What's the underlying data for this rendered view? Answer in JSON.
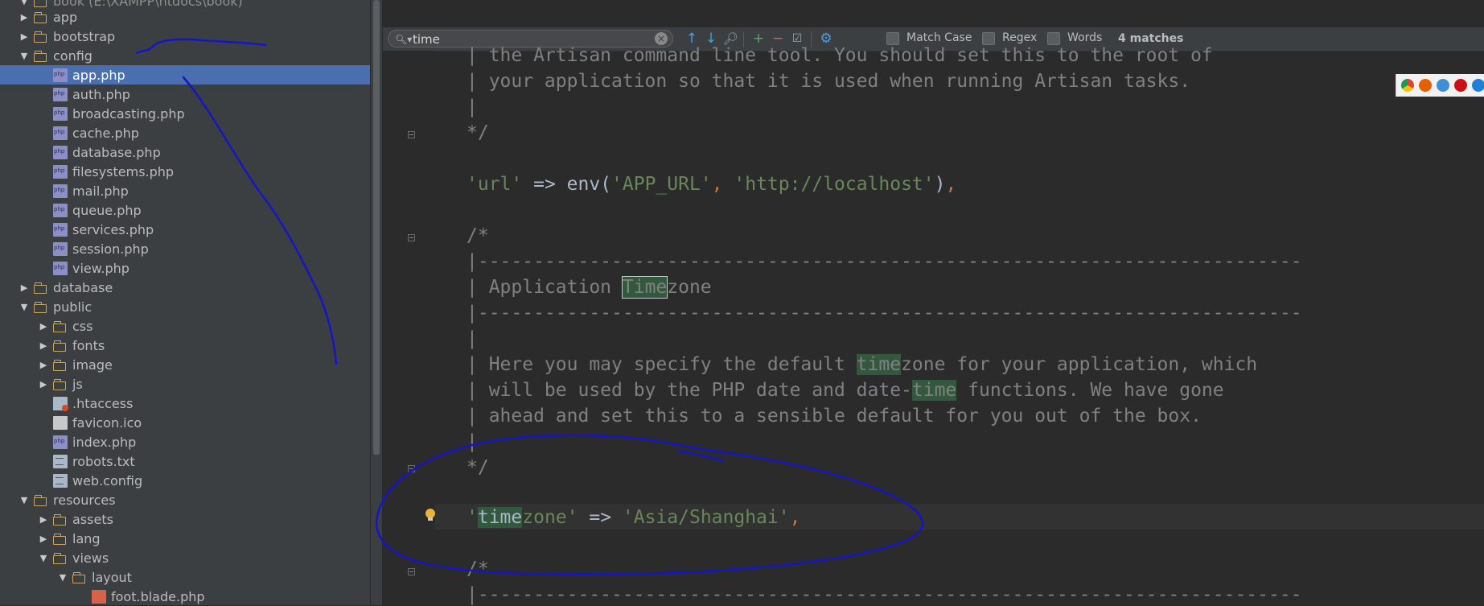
{
  "project_tree": {
    "root_label": "book (E:\\XAMPP\\htdocs\\book)",
    "rows": [
      {
        "label": "app",
        "type": "folder",
        "indent": 0,
        "arrow": "▶"
      },
      {
        "label": "bootstrap",
        "type": "folder",
        "indent": 0,
        "arrow": "▶"
      },
      {
        "label": "config",
        "type": "folder",
        "indent": 0,
        "arrow": "▼"
      },
      {
        "label": "app.php",
        "type": "php",
        "indent": 1,
        "arrow": "",
        "selected": true
      },
      {
        "label": "auth.php",
        "type": "php",
        "indent": 1,
        "arrow": ""
      },
      {
        "label": "broadcasting.php",
        "type": "php",
        "indent": 1,
        "arrow": ""
      },
      {
        "label": "cache.php",
        "type": "php",
        "indent": 1,
        "arrow": ""
      },
      {
        "label": "database.php",
        "type": "php",
        "indent": 1,
        "arrow": ""
      },
      {
        "label": "filesystems.php",
        "type": "php",
        "indent": 1,
        "arrow": ""
      },
      {
        "label": "mail.php",
        "type": "php",
        "indent": 1,
        "arrow": ""
      },
      {
        "label": "queue.php",
        "type": "php",
        "indent": 1,
        "arrow": ""
      },
      {
        "label": "services.php",
        "type": "php",
        "indent": 1,
        "arrow": ""
      },
      {
        "label": "session.php",
        "type": "php",
        "indent": 1,
        "arrow": ""
      },
      {
        "label": "view.php",
        "type": "php",
        "indent": 1,
        "arrow": ""
      },
      {
        "label": "database",
        "type": "folder",
        "indent": 0,
        "arrow": "▶"
      },
      {
        "label": "public",
        "type": "folder",
        "indent": 0,
        "arrow": "▼"
      },
      {
        "label": "css",
        "type": "folder",
        "indent": 1,
        "arrow": "▶"
      },
      {
        "label": "fonts",
        "type": "folder",
        "indent": 1,
        "arrow": "▶"
      },
      {
        "label": "image",
        "type": "folder",
        "indent": 1,
        "arrow": "▶"
      },
      {
        "label": "js",
        "type": "folder",
        "indent": 1,
        "arrow": "▶"
      },
      {
        "label": ".htaccess",
        "type": "htaccess",
        "indent": 1,
        "arrow": ""
      },
      {
        "label": "favicon.ico",
        "type": "ico",
        "indent": 1,
        "arrow": ""
      },
      {
        "label": "index.php",
        "type": "php",
        "indent": 1,
        "arrow": ""
      },
      {
        "label": "robots.txt",
        "type": "txt",
        "indent": 1,
        "arrow": ""
      },
      {
        "label": "web.config",
        "type": "txt",
        "indent": 1,
        "arrow": ""
      },
      {
        "label": "resources",
        "type": "folder",
        "indent": 0,
        "arrow": "▼"
      },
      {
        "label": "assets",
        "type": "folder",
        "indent": 1,
        "arrow": "▶"
      },
      {
        "label": "lang",
        "type": "folder",
        "indent": 1,
        "arrow": "▶"
      },
      {
        "label": "views",
        "type": "folder",
        "indent": 1,
        "arrow": "▼"
      },
      {
        "label": "layout",
        "type": "folder",
        "indent": 2,
        "arrow": "▼"
      },
      {
        "label": "foot.blade.php",
        "type": "blade",
        "indent": 3,
        "arrow": ""
      }
    ]
  },
  "search": {
    "query": "time",
    "options": {
      "match_case": "Match Case",
      "regex": "Regex",
      "words": "Words"
    },
    "match_count": "4 matches"
  },
  "code": {
    "line_1": "| the Artisan command line tool. You should set this to the root of",
    "line_2": "| your application so that it is used when running Artisan tasks.",
    "line_3": "|",
    "line_4": "*/",
    "url_key": "'url'",
    "url_arrow": " => ",
    "url_fn": "env",
    "url_paren_open": "(",
    "url_arg1": "'APP_URL'",
    "url_comma": ", ",
    "url_arg2": "'http://localhost'",
    "url_paren_close": ")",
    "url_end": ",",
    "comment_open": "/*",
    "rule": "|--------------------------------------------------------------------------",
    "heading_prefix": "| Application ",
    "heading_match": "Time",
    "heading_suffix": "zone",
    "blank_pipe": "|",
    "desc1_prefix": "| Here you may specify the default ",
    "desc1_match": "time",
    "desc1_suffix": "zone for your application, which",
    "desc2_prefix": "| will be used by the PHP date and date-",
    "desc2_match": "time",
    "desc2_suffix": " functions. We have gone",
    "desc3": "| ahead and set this to a sensible default for you out of the box.",
    "comment_close": "*/",
    "tz_quote": "'",
    "tz_match": "time",
    "tz_rest": "zone'",
    "tz_arrow": " => ",
    "tz_value": "'Asia/Shanghai'",
    "tz_end": ","
  },
  "colors": {
    "selection": "#4b6eaf",
    "match_highlight": "#32593d",
    "annotation_ink": "#1515c8"
  }
}
